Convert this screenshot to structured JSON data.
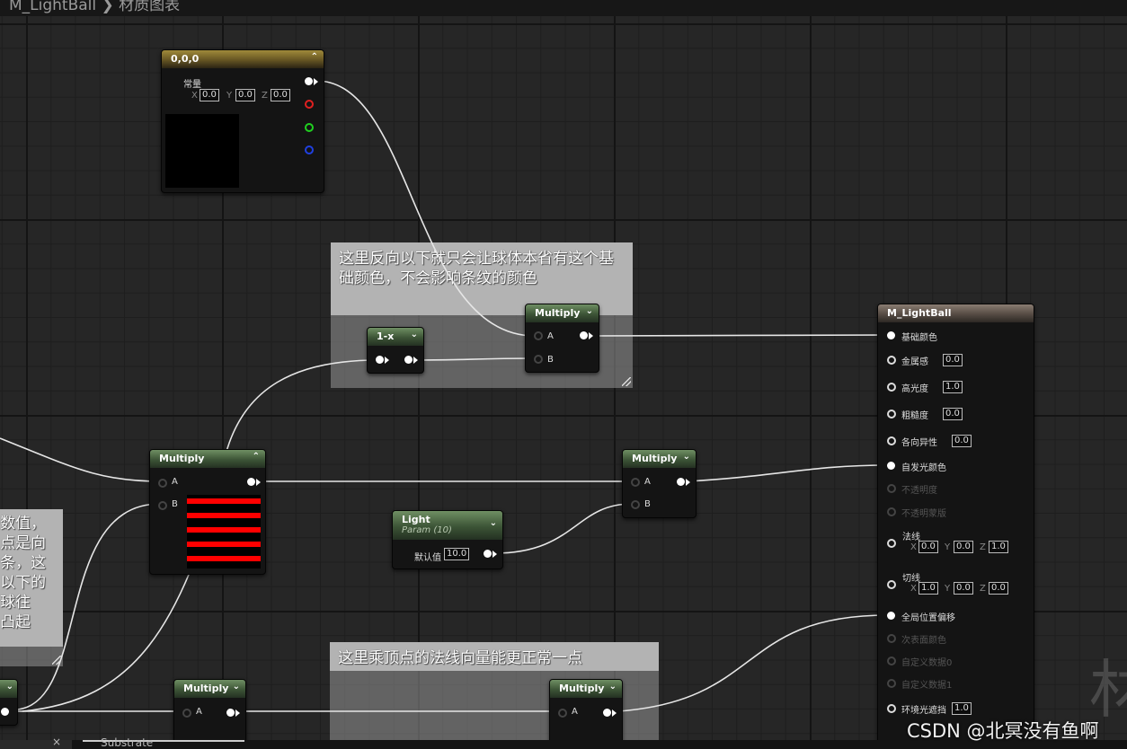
{
  "topbar": {
    "breadcrumb": "M_LightBall ❯ 材质图表"
  },
  "comments": {
    "top": "这里反向以下就只会让球体本省有这个基础颜色，不会影响条纹的颜色",
    "left": "数值，\n点是向\n条，这\n以下的\n球往\n凸起",
    "bottom": "这里乘顶点的法线向量能更正常一点"
  },
  "constant_node": {
    "title": "0,0,0",
    "label": "常量",
    "x_label": "X",
    "x": "0.0",
    "y_label": "Y",
    "y": "0.0",
    "z_label": "Z",
    "z": "0.0"
  },
  "oneminus_node": {
    "title": "1-x"
  },
  "multiply_label": "Multiply",
  "pin_a": "A",
  "pin_b": "B",
  "light_node": {
    "title": "Light",
    "subtitle": "Param (10)",
    "label": "默认值",
    "value": "10.0"
  },
  "material_node": {
    "title": "M_LightBall",
    "base_color": "基础颜色",
    "metallic": "金属感",
    "metallic_value": "0.0",
    "specular": "高光度",
    "specular_value": "1.0",
    "roughness": "粗糙度",
    "roughness_value": "0.0",
    "anisotropy": "各向异性",
    "anisotropy_value": "0.0",
    "emissive": "自发光颜色",
    "opacity": "不透明度",
    "opacity_mask": "不透明蒙版",
    "normal": "法线",
    "normal_x": "0.0",
    "normal_y": "0.0",
    "normal_z": "1.0",
    "tangent": "切线",
    "tangent_x": "1.0",
    "tangent_y": "0.0",
    "tangent_z": "0.0",
    "wpo": "全局位置偏移",
    "subsurface": "次表面颜色",
    "custom0": "自定义数据0",
    "custom1": "自定义数据1",
    "ao": "环境光遮挡",
    "ao_value": "1.0"
  },
  "axis": {
    "x": "X",
    "y": "Y",
    "z": "Z"
  },
  "bottom_tab": {
    "close": "×",
    "label": "Substrate"
  },
  "watermark": "CSDN @北冥没有鱼啊",
  "corner_glyph": "材"
}
